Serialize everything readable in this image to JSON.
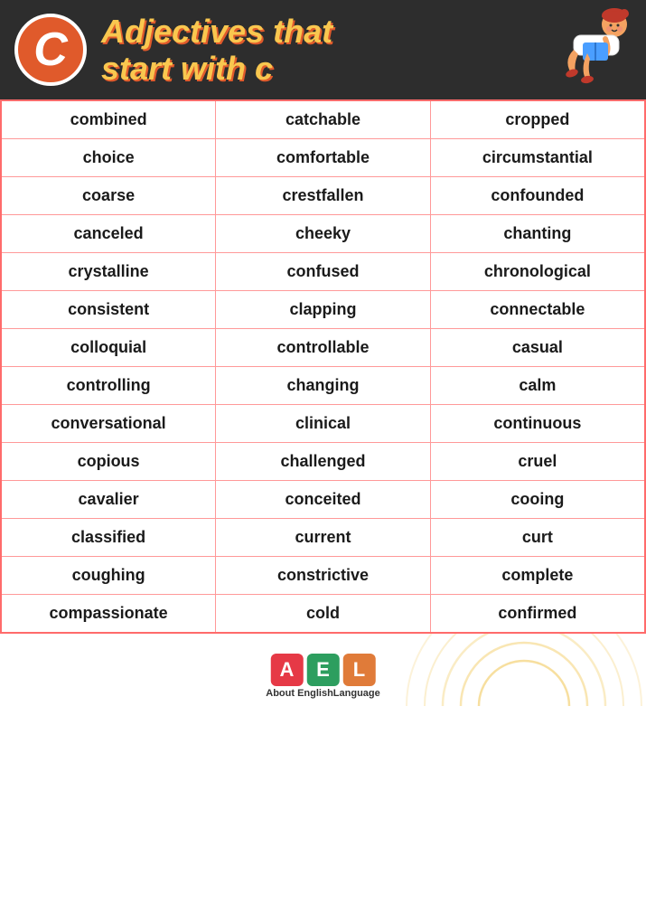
{
  "header": {
    "letter": "C",
    "title_line1": "Adjectives that",
    "title_line2": "start with c"
  },
  "table": {
    "rows": [
      [
        "combined",
        "catchable",
        "cropped"
      ],
      [
        "choice",
        "comfortable",
        "circumstantial"
      ],
      [
        "coarse",
        "crestfallen",
        "confounded"
      ],
      [
        "canceled",
        "cheeky",
        "chanting"
      ],
      [
        "crystalline",
        "confused",
        "chronological"
      ],
      [
        "consistent",
        "clapping",
        "connectable"
      ],
      [
        "colloquial",
        "controllable",
        "casual"
      ],
      [
        "controlling",
        "changing",
        "calm"
      ],
      [
        "conversational",
        "clinical",
        "continuous"
      ],
      [
        "copious",
        "challenged",
        "cruel"
      ],
      [
        "cavalier",
        "conceited",
        "cooing"
      ],
      [
        "classified",
        "current",
        "curt"
      ],
      [
        "coughing",
        "constrictive",
        "complete"
      ],
      [
        "compassionate",
        "cold",
        "confirmed"
      ]
    ]
  },
  "footer": {
    "logo_letters": [
      "A",
      "E",
      "L"
    ],
    "logo_text": "About EnglishLanguage"
  }
}
